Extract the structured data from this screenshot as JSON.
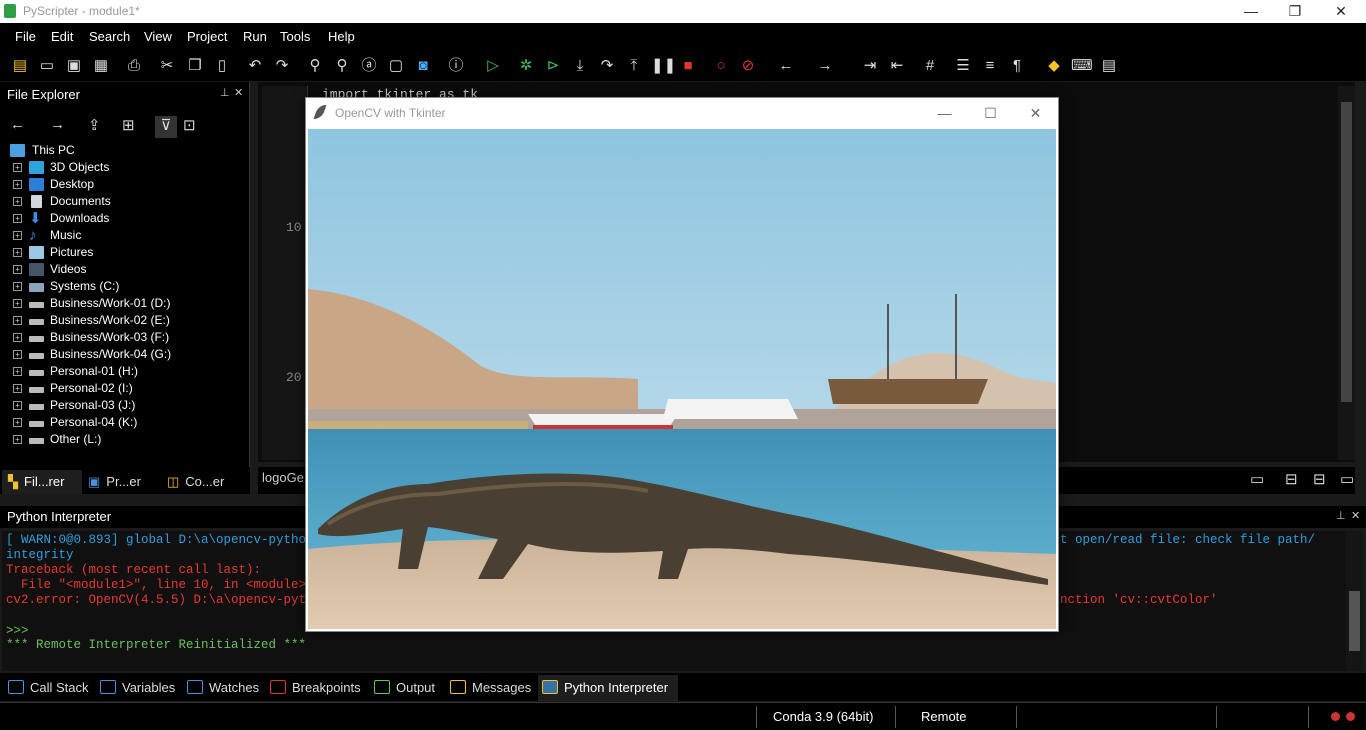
{
  "window": {
    "title": "PyScripter - module1*",
    "min": "—",
    "max": "❐",
    "close": "✕"
  },
  "menu": [
    "File",
    "Edit",
    "Search",
    "View",
    "Project",
    "Run",
    "Tools",
    "Help"
  ],
  "file_explorer": {
    "title": "File Explorer",
    "root": "This PC",
    "items": [
      "3D Objects",
      "Desktop",
      "Documents",
      "Downloads",
      "Music",
      "Pictures",
      "Videos",
      "Systems (C:)",
      "Business/Work-01 (D:)",
      "Business/Work-02 (E:)",
      "Business/Work-03 (F:)",
      "Business/Work-04 (G:)",
      "Personal-01 (H:)",
      "Personal-02 (I:)",
      "Personal-03 (J:)",
      "Personal-04 (K:)",
      "Other (L:)"
    ],
    "tabs": [
      "Fil...rer",
      "Pr...er",
      "Co...er"
    ]
  },
  "editor": {
    "code_line1": "import tkinter as tk",
    "line_numbers": [
      "10",
      "20"
    ],
    "tab_label": "logoGe"
  },
  "tk_window": {
    "title": "OpenCV with Tkinter",
    "min": "—",
    "max": "☐",
    "close": "✕",
    "photo_subject": "komodo dragon on beach, boats in harbor"
  },
  "interpreter": {
    "title": "Python Interpreter",
    "lines": [
      {
        "text": "[ WARN:0@0.893] global D:\\a\\opencv-python\\c",
        "cls": "cyan"
      },
      {
        "text": "integrity",
        "cls": "cyan"
      },
      {
        "text": "Traceback (most recent call last):",
        "cls": "red"
      },
      {
        "text": "  File \"<module1>\", line 10, in <module>",
        "cls": "red"
      },
      {
        "text": "cv2.error: OpenCV(4.5.5) D:\\a\\opencv-python",
        "cls": "red"
      },
      {
        "text": "",
        "cls": ""
      },
      {
        "text": ">>>",
        "cls": "green"
      },
      {
        "text": "*** Remote Interpreter Reinitialized ***",
        "cls": "green"
      }
    ],
    "right_fragments": {
      "warn_tail": "t open/read file: check file path/",
      "err_tail": "nction 'cv::cvtColor'"
    }
  },
  "bottom_tabs": [
    "Call Stack",
    "Variables",
    "Watches",
    "Breakpoints",
    "Output",
    "Messages",
    "Python Interpreter"
  ],
  "status": {
    "env": "Conda 3.9 (64bit)",
    "mode": "Remote"
  }
}
